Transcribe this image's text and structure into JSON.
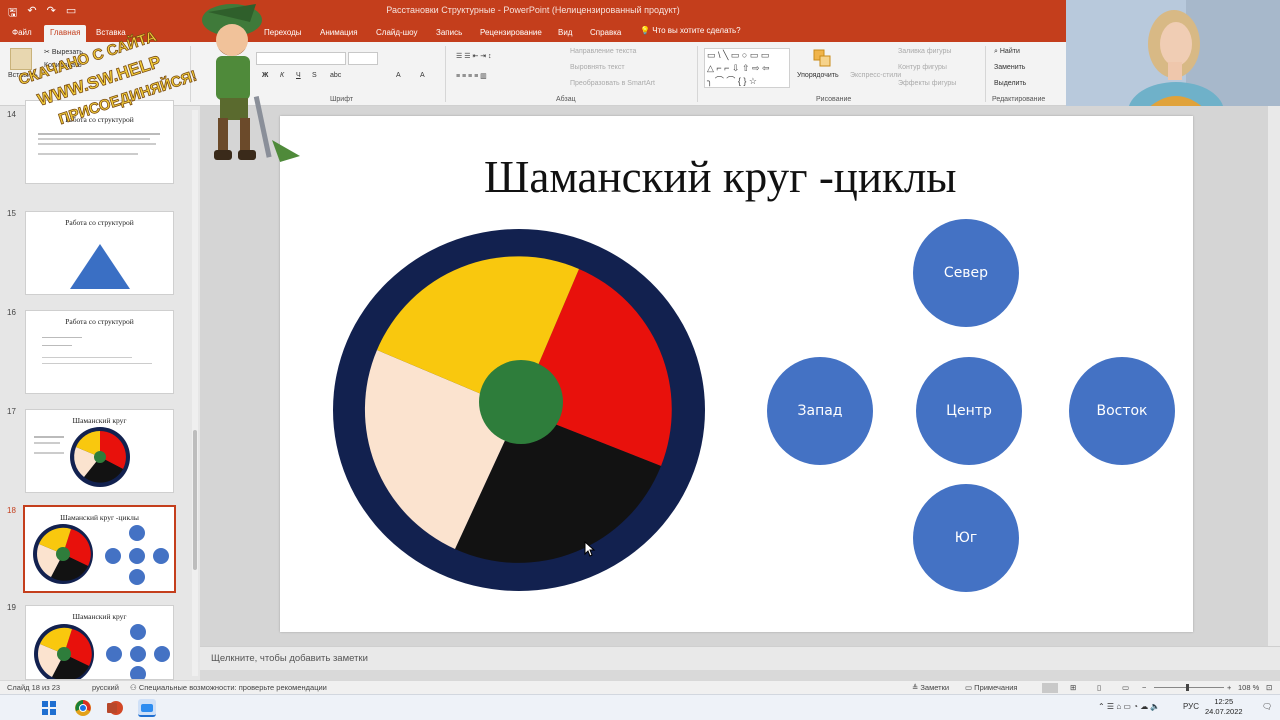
{
  "window": {
    "title": "Расстановки Структурные - PowerPoint (Нелицензированный продукт)"
  },
  "tabs": [
    "Файл",
    "Главная",
    "Вставка",
    "Переходы",
    "Анимация",
    "Слайд-шоу",
    "Запись",
    "Рецензирование",
    "Вид",
    "Справка"
  ],
  "tell_me": "Что вы хотите сделать?",
  "ribbon": {
    "paste_label": "Вставить",
    "cut_label": "Вырезать",
    "copy_label": "Копировать",
    "font_group": "Шрифт",
    "paragraph_group": "Абзац",
    "drawing_group": "Рисование",
    "editing_group": "Редактирование",
    "text_direction": "Направление текста",
    "align_text": "Выровнять текст",
    "convert_smartart": "Преобразовать в SmartArt",
    "arrange_label": "Упорядочить",
    "quick_styles_label": "Экспресс-стили",
    "shape_fill": "Заливка фигуры",
    "shape_outline": "Контур фигуры",
    "shape_effects": "Эффекты фигуры",
    "find_label": "Найти",
    "replace_label": "Заменить",
    "select_label": "Выделить"
  },
  "thumbnails": [
    {
      "number": "14",
      "title": "Работа со структурой"
    },
    {
      "number": "15",
      "title": "Работа со структурой"
    },
    {
      "number": "16",
      "title": "Работа со структурой"
    },
    {
      "number": "17",
      "title": "Шаманский круг"
    },
    {
      "number": "18",
      "title": "Шаманский круг -циклы"
    },
    {
      "number": "19",
      "title": "Шаманский круг"
    }
  ],
  "slide": {
    "title": "Шаманский круг -циклы",
    "wheel_colors": {
      "ring": "#12214f",
      "yellow": "#f9c80e",
      "red": "#e8110c",
      "black": "#121212",
      "beige": "#fbe3cf",
      "center": "#2e7d3b"
    },
    "nodes": {
      "north": "Север",
      "west": "Запад",
      "center": "Центр",
      "east": "Восток",
      "south": "Юг"
    },
    "node_color": "#4472c4"
  },
  "notes_placeholder": "Щелкните, чтобы добавить заметки",
  "status": {
    "slide_counter": "Слайд 18 из 23",
    "language": "русский",
    "accessibility": "Специальные возможности: проверьте рекомендации",
    "notes_btn": "Заметки",
    "comments_btn": "Примечания",
    "zoom": "108 %"
  },
  "taskbar": {
    "lang": "РУС",
    "time": "12:25",
    "date": "24.07.2022"
  },
  "watermark": {
    "line1": "СКАЧАНО С САЙТА",
    "line2": "WWW.SW.HELP",
    "line3": "ПРИСОЕДИНЯЙСЯ!"
  }
}
